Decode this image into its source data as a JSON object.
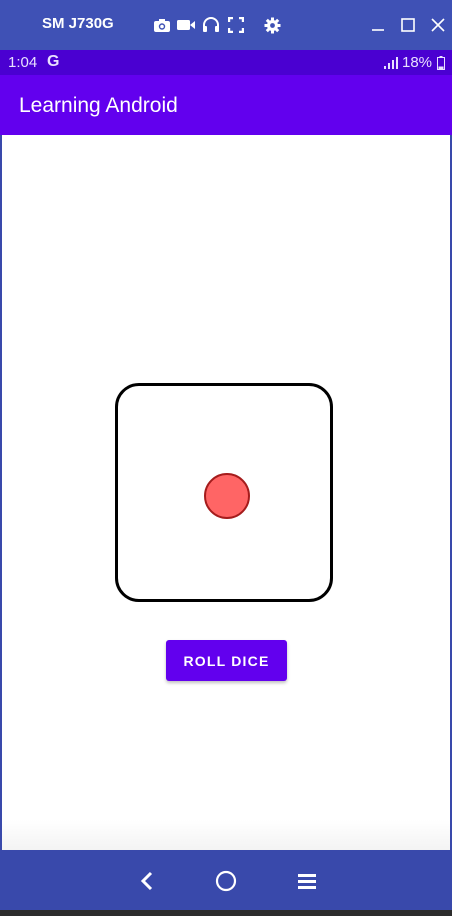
{
  "window": {
    "device_name": "SM J730G",
    "tools": [
      "camera-icon",
      "video-icon",
      "headphones-icon",
      "fullscreen-icon",
      "settings-icon"
    ],
    "controls": [
      "minimize-icon",
      "maximize-icon",
      "close-icon"
    ]
  },
  "status_bar": {
    "time": "1:04",
    "notification": "G",
    "battery": "18%"
  },
  "app_bar": {
    "title": "Learning Android"
  },
  "main": {
    "die_face_value": 1,
    "roll_button_label": "ROLL DICE"
  },
  "nav_bar": {
    "buttons": [
      "back-icon",
      "home-icon",
      "menu-icon"
    ]
  },
  "colors": {
    "window_bar": "#3f51b5",
    "status_bar": "#4a00d1",
    "app_bar": "#6200ee",
    "pip": "#ff6565",
    "nav_bar": "#3949ab"
  }
}
